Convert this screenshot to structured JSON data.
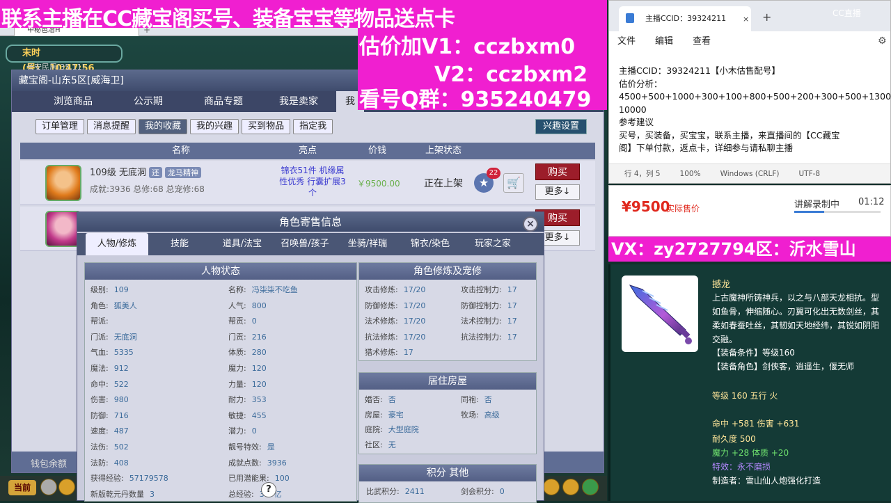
{
  "overlay": {
    "line1": "联系主播在CC藏宝阁买号、装备宝宝等物品送点卡",
    "line2": "估价加V1：cczbxm0",
    "line3": "V2：cczbxm2",
    "line4": "看号Q群：935240479",
    "vx": "VX：zy2727794区：沂水雪山"
  },
  "game": {
    "tab_title": "中秘笆冶H",
    "clock": {
      "period": "末时(昼)",
      "time": "10:47:56"
    },
    "map_sub": "长安民居[35,11]",
    "wallet": "钱包余额",
    "hud_current": "当前"
  },
  "mall": {
    "title": "藏宝阁-山东5区[威海卫]",
    "tabs": [
      "浏览商品",
      "公示期",
      "商品专题",
      "我是卖家",
      "我"
    ],
    "subtabs": [
      "订单管理",
      "消息提醒",
      "我的收藏",
      "我的兴趣",
      "买到物品",
      "指定我"
    ],
    "alert_settings": "兴趣设置",
    "headers": {
      "name": "名称",
      "highlight": "亮点",
      "price": "价钱",
      "status": "上架状态"
    },
    "rows": [
      {
        "name": "109级 无底洞",
        "badge1": "还",
        "badge2": "龙马精神",
        "stats": "成就:3936 总修:68 总宠修:68",
        "highlight": "锦衣51件 机缘属性优秀 行囊扩展3个",
        "price": "￥9500.00",
        "status": "正在上架",
        "fav_count": "22",
        "buy": "购买",
        "more": "更多↓"
      },
      {
        "buy": "购买",
        "more": "更多↓"
      }
    ]
  },
  "dialog": {
    "title": "角色寄售信息",
    "close": "×",
    "tabs": [
      "人物/修炼",
      "技能",
      "道具/法宝",
      "召唤兽/孩子",
      "坐骑/祥瑞",
      "锦衣/染色",
      "玩家之家"
    ],
    "status_title": "人物状态",
    "status_left": [
      {
        "k": "级别:",
        "v": "109"
      },
      {
        "k": "角色:",
        "v": "狐美人"
      },
      {
        "k": "帮派:",
        "v": ""
      },
      {
        "k": "门派:",
        "v": "无底洞"
      },
      {
        "k": "气血:",
        "v": "5335"
      },
      {
        "k": "魔法:",
        "v": "912"
      },
      {
        "k": "命中:",
        "v": "522"
      },
      {
        "k": "伤害:",
        "v": "980"
      },
      {
        "k": "防御:",
        "v": "716"
      },
      {
        "k": "速度:",
        "v": "487"
      },
      {
        "k": "法伤:",
        "v": "502"
      },
      {
        "k": "法防:",
        "v": "408"
      },
      {
        "k": "获得经验:",
        "v": "57179578"
      },
      {
        "k": "新版乾元丹数量",
        "v": "3"
      }
    ],
    "status_right": [
      {
        "k": "名称:",
        "v": "冯柒柒不吃鱼"
      },
      {
        "k": "人气:",
        "v": "800"
      },
      {
        "k": "帮贡:",
        "v": "0"
      },
      {
        "k": "门贡:",
        "v": "216"
      },
      {
        "k": "体质:",
        "v": "280"
      },
      {
        "k": "魔力:",
        "v": "120"
      },
      {
        "k": "力量:",
        "v": "120"
      },
      {
        "k": "耐力:",
        "v": "353"
      },
      {
        "k": "敏捷:",
        "v": "455"
      },
      {
        "k": "潜力:",
        "v": "0"
      },
      {
        "k": "靓号特效:",
        "v": "是"
      },
      {
        "k": "成就点数:",
        "v": "3936"
      },
      {
        "k": "已用潜能果:",
        "v": "100"
      },
      {
        "k": "总经验:",
        "v": "389亿"
      }
    ],
    "refine_title": "角色修炼及宠修",
    "refine_left": [
      {
        "k": "攻击修炼:",
        "v": "17/20"
      },
      {
        "k": "防御修炼:",
        "v": "17/20"
      },
      {
        "k": "法术修炼:",
        "v": "17/20"
      },
      {
        "k": "抗法修炼:",
        "v": "17/20"
      },
      {
        "k": "猎术修炼:",
        "v": "17"
      }
    ],
    "refine_right": [
      {
        "k": "攻击控制力:",
        "v": "17"
      },
      {
        "k": "防御控制力:",
        "v": "17"
      },
      {
        "k": "法术控制力:",
        "v": "17"
      },
      {
        "k": "抗法控制力:",
        "v": "17"
      }
    ],
    "house_title": "居住房屋",
    "house_left": [
      {
        "k": "婚否:",
        "v": "否"
      },
      {
        "k": "房屋:",
        "v": "豪宅"
      },
      {
        "k": "庭院:",
        "v": "大型庭院"
      },
      {
        "k": "社区:",
        "v": "无"
      }
    ],
    "house_right": [
      {
        "k": "同袍:",
        "v": "否"
      },
      {
        "k": "牧场:",
        "v": "高级"
      }
    ],
    "score_title": "积分 其他",
    "score_left": {
      "k": "比武积分:",
      "v": "2411"
    },
    "score_right": {
      "k": "剑会积分:",
      "v": "0"
    }
  },
  "notepad": {
    "tab_title": "主播CCID：39324211",
    "close": "×",
    "plus": "+",
    "menu": [
      "文件",
      "编辑",
      "查看"
    ],
    "lines": [
      "主播CCID：39324211【小木估售配号】",
      "估价分析：",
      "4500+500+1000+300+100+800+500+200+300+500+1300=",
      "10000",
      "参考建议",
      "买号，买装备，买宝宝，联系主播，来直播间的【CC藏宝",
      "阁】下单付款，返点卡，详细参与请私聊主播"
    ],
    "status": [
      "行 4，列 5",
      "100%",
      "Windows (CRLF)",
      "UTF-8"
    ]
  },
  "cc": {
    "logo": "CC直播",
    "logo_small": "CC直播"
  },
  "price_card": {
    "price": "¥9500",
    "label": "实际售价",
    "rec_label": "讲解录制中",
    "rec_time": "01:12",
    "rec_progress": 0.35
  },
  "item": {
    "name": "撼龙",
    "desc": "上古魔神所铸神兵，以之与八部天龙相抗。型如鱼骨，伸缩随心。刃翼可化出无数剑丝，其柔如春蚕吐丝，其韧如天地经纬，其锐如阴阳交融。",
    "cond": "【装备条件】等级160",
    "role": "【装备角色】剑侠客，逍遥生，偃无师",
    "level": "等级 160  五行 火",
    "stat1": "命中 +581 伤害 +631",
    "durability": "耐久度 500",
    "stat2": "魔力 +28 体质 +20",
    "effect": "特效：永不磨损",
    "maker": "制造者：雪山仙人炮强化打造"
  },
  "colors": {
    "magenta": "#f01fd0",
    "buy_red": "#9c1d2a",
    "price_red": "#e0281d",
    "panel_teal": "#143a36"
  }
}
